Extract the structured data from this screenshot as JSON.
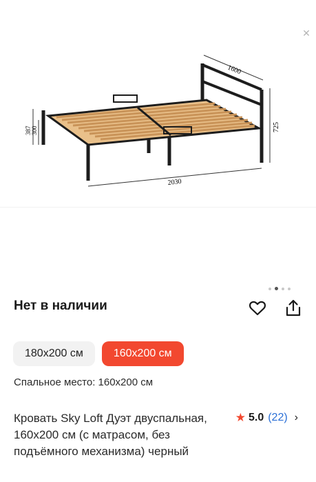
{
  "gallery": {
    "close_icon": "close-icon",
    "dimensions": {
      "width": "1600",
      "length": "2030",
      "height_head": "725",
      "height_total": "387",
      "height_frame": "300"
    },
    "dots_count": 4,
    "active_dot": 1
  },
  "product": {
    "availability": "Нет в наличии",
    "sizes": [
      {
        "label": "180x200 см",
        "selected": false
      },
      {
        "label": "160x200 см",
        "selected": true
      }
    ],
    "sleep_place": "Спальное место: 160x200 см",
    "title": "Кровать Sky Loft Дуэт двуспальная, 160x200 см (с матрасом, без подъёмного механизма) черный",
    "rating": {
      "value": "5.0",
      "reviews": "(22)"
    }
  },
  "colors": {
    "accent": "#f2482f",
    "link": "#2a6fd6"
  }
}
